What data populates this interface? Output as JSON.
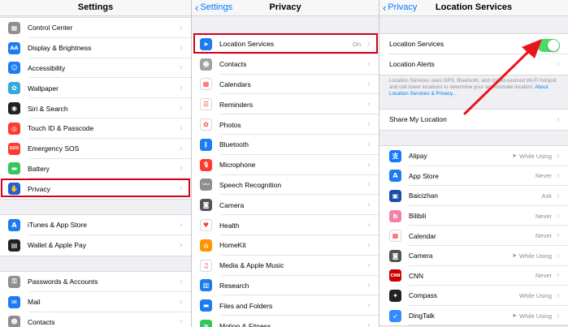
{
  "colors": {
    "highlight": "#d0021b",
    "ios_blue": "#007aff",
    "toggle_on": "#4cd964"
  },
  "settings": {
    "title": "Settings",
    "group1": [
      {
        "label": "Control Center",
        "icon": "control-center-icon",
        "color": "#8e8e93",
        "glyph": "▦"
      },
      {
        "label": "Display & Brightness",
        "icon": "display-icon",
        "color": "#1e7cf2",
        "glyph": "AA"
      },
      {
        "label": "Accessibility",
        "icon": "accessibility-icon",
        "color": "#1e7cf2",
        "glyph": "☺"
      },
      {
        "label": "Wallpaper",
        "icon": "wallpaper-icon",
        "color": "#35aadc",
        "glyph": "✿"
      },
      {
        "label": "Siri & Search",
        "icon": "siri-icon",
        "color": "#222222",
        "glyph": "◉"
      },
      {
        "label": "Touch ID & Passcode",
        "icon": "touch-id-icon",
        "color": "#ff3b30",
        "glyph": "◎"
      },
      {
        "label": "Emergency SOS",
        "icon": "sos-icon",
        "color": "#ff3b30",
        "glyph": "SOS"
      },
      {
        "label": "Battery",
        "icon": "battery-icon",
        "color": "#34c759",
        "glyph": "▬"
      },
      {
        "label": "Privacy",
        "icon": "privacy-hand-icon",
        "color": "#1e5fd6",
        "glyph": "✋"
      }
    ],
    "group2": [
      {
        "label": "iTunes & App Store",
        "icon": "app-store-icon",
        "color": "#1e7cf2",
        "glyph": "A"
      },
      {
        "label": "Wallet & Apple Pay",
        "icon": "wallet-icon",
        "color": "#222222",
        "glyph": "▤"
      }
    ],
    "group3": [
      {
        "label": "Passwords & Accounts",
        "icon": "key-icon",
        "color": "#8e8e93",
        "glyph": "⚿"
      },
      {
        "label": "Mail",
        "icon": "mail-icon",
        "color": "#1e7cf2",
        "glyph": "✉"
      },
      {
        "label": "Contacts",
        "icon": "contacts-icon",
        "color": "#8e8e93",
        "glyph": "☻"
      }
    ]
  },
  "privacy": {
    "back": "Settings",
    "title": "Privacy",
    "items": [
      {
        "label": "Location Services",
        "value": "On",
        "icon": "location-arrow-icon",
        "color": "#1e7cf2",
        "glyph": "➤"
      },
      {
        "label": "Contacts",
        "value": "",
        "icon": "contacts-icon",
        "color": "#a0a0a5",
        "glyph": "☻"
      },
      {
        "label": "Calendars",
        "value": "",
        "icon": "calendar-icon",
        "color": "#ffffff",
        "glyph": "▦"
      },
      {
        "label": "Reminders",
        "value": "",
        "icon": "reminders-icon",
        "color": "#ffffff",
        "glyph": "☰"
      },
      {
        "label": "Photos",
        "value": "",
        "icon": "photos-icon",
        "color": "#ffffff",
        "glyph": "✿"
      },
      {
        "label": "Bluetooth",
        "value": "",
        "icon": "bluetooth-icon",
        "color": "#1e7cf2",
        "glyph": "ᛒ"
      },
      {
        "label": "Microphone",
        "value": "",
        "icon": "microphone-icon",
        "color": "#ff3b30",
        "glyph": "🎙"
      },
      {
        "label": "Speech Recognition",
        "value": "",
        "icon": "speech-wave-icon",
        "color": "#8e8e93",
        "glyph": "〰"
      },
      {
        "label": "Camera",
        "value": "",
        "icon": "camera-icon",
        "color": "#555555",
        "glyph": "◙"
      },
      {
        "label": "Health",
        "value": "",
        "icon": "health-heart-icon",
        "color": "#ffffff",
        "glyph": "♥"
      },
      {
        "label": "HomeKit",
        "value": "",
        "icon": "homekit-icon",
        "color": "#ff9500",
        "glyph": "⌂"
      },
      {
        "label": "Media & Apple Music",
        "value": "",
        "icon": "music-note-icon",
        "color": "#ffffff",
        "glyph": "♫"
      },
      {
        "label": "Research",
        "value": "",
        "icon": "research-icon",
        "color": "#1e7cf2",
        "glyph": "▥"
      },
      {
        "label": "Files and Folders",
        "value": "",
        "icon": "folder-icon",
        "color": "#1e7cf2",
        "glyph": "▬"
      },
      {
        "label": "Motion & Fitness",
        "value": "",
        "icon": "motion-icon",
        "color": "#34c759",
        "glyph": "≈"
      }
    ]
  },
  "location": {
    "back": "Privacy",
    "title": "Location Services",
    "toggle_label": "Location Services",
    "alerts_label": "Location Alerts",
    "description": "Location Services uses GPS, Bluetooth, and crowd-sourced Wi-Fi hotspot and cell tower locations to determine your approximate location.",
    "description_link": "About Location Services & Privacy...",
    "share_label": "Share My Location",
    "apps": [
      {
        "name": "Alipay",
        "value": "While Using",
        "arrow": true,
        "icon": "alipay-icon",
        "color": "#1677ff",
        "glyph": "支"
      },
      {
        "name": "App Store",
        "value": "Never",
        "arrow": false,
        "icon": "app-store-icon",
        "color": "#1e7cf2",
        "glyph": "A"
      },
      {
        "name": "Baicizhan",
        "value": "Ask",
        "arrow": false,
        "icon": "baicizhan-icon",
        "color": "#1d4fa8",
        "glyph": "▣"
      },
      {
        "name": "Bilibili",
        "value": "Never",
        "arrow": false,
        "icon": "bilibili-icon",
        "color": "#f57fa5",
        "glyph": "b"
      },
      {
        "name": "Calendar",
        "value": "Never",
        "arrow": false,
        "icon": "calendar-icon",
        "color": "#ffffff",
        "glyph": "▦"
      },
      {
        "name": "Camera",
        "value": "While Using",
        "arrow": true,
        "icon": "camera-icon",
        "color": "#555555",
        "glyph": "◙"
      },
      {
        "name": "CNN",
        "value": "Never",
        "arrow": false,
        "icon": "cnn-icon",
        "color": "#cc0000",
        "glyph": "CNN"
      },
      {
        "name": "Compass",
        "value": "While Using",
        "arrow": false,
        "icon": "compass-icon",
        "color": "#222222",
        "glyph": "✦"
      },
      {
        "name": "DingTalk",
        "value": "While Using",
        "arrow": true,
        "icon": "dingtalk-icon",
        "color": "#2e8cff",
        "glyph": "➶"
      }
    ]
  }
}
